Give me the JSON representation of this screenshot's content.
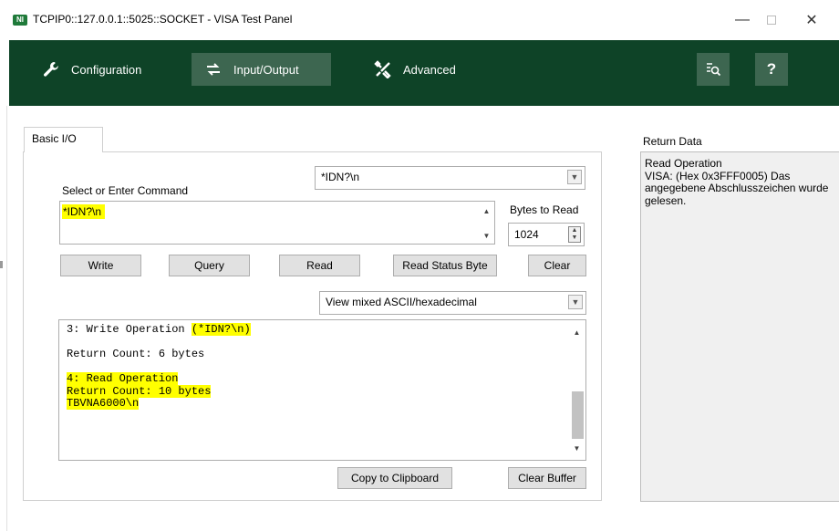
{
  "window": {
    "app_icon_text": "NI",
    "title": "TCPIP0::127.0.0.1::5025::SOCKET - VISA Test Panel",
    "minimize": "—",
    "close": "✕"
  },
  "toolbar": {
    "configuration": "Configuration",
    "input_output": "Input/Output",
    "advanced": "Advanced",
    "find_glyph": "🔍",
    "help": "?"
  },
  "tabs": {
    "basic_io": "Basic I/O"
  },
  "command": {
    "label": "Select or Enter Command",
    "dropdown_value": "*IDN?\\n",
    "input_value": "*IDN?\\n",
    "bytes_to_read_label": "Bytes to Read",
    "bytes_to_read_value": "1024"
  },
  "buttons": {
    "write": "Write",
    "query": "Query",
    "read": "Read",
    "read_status_byte": "Read Status Byte",
    "clear": "Clear",
    "copy_to_clipboard": "Copy to Clipboard",
    "clear_buffer": "Clear Buffer"
  },
  "view_mode": {
    "selected": "View mixed ASCII/hexadecimal"
  },
  "output": {
    "lines": [
      {
        "text": "3: Write Operation ",
        "highlight": "(*IDN?\\n)"
      },
      {
        "text": "",
        "highlight": ""
      },
      {
        "text": "Return Count: 6 bytes",
        "highlight": ""
      },
      {
        "text": "",
        "highlight": ""
      },
      {
        "text": "",
        "highlight": "4: Read Operation"
      },
      {
        "text": "",
        "highlight": "Return Count: 10 bytes"
      },
      {
        "text": "",
        "highlight": "TBVNA6000\\n"
      }
    ]
  },
  "return_data": {
    "title": "Return Data",
    "operation": "Read Operation",
    "message": "VISA: (Hex 0x3FFF0005) Das angegebene Abschlusszeichen wurde gelesen."
  },
  "colors": {
    "toolbar_bg": "#0e4327",
    "toolbar_active": "#3d6650",
    "highlight": "#ffff00"
  }
}
